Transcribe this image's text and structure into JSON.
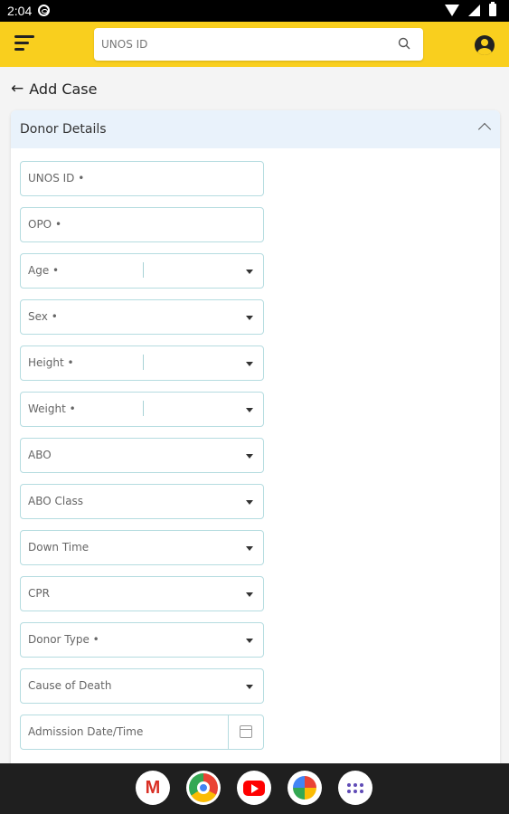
{
  "status_bar": {
    "time": "2:04"
  },
  "header": {
    "search": {
      "placeholder": "UNOS ID",
      "value": ""
    }
  },
  "page": {
    "back_label": "Add Case"
  },
  "section": {
    "title": "Donor Details",
    "fields": [
      {
        "label": "UNOS ID •",
        "kind": "text"
      },
      {
        "label": "OPO •",
        "kind": "text"
      },
      {
        "label": "Age •",
        "kind": "unit-select"
      },
      {
        "label": "Sex •",
        "kind": "select"
      },
      {
        "label": "Height •",
        "kind": "unit-select"
      },
      {
        "label": "Weight •",
        "kind": "unit-select"
      },
      {
        "label": "ABO",
        "kind": "select"
      },
      {
        "label": "ABO Class",
        "kind": "select"
      },
      {
        "label": "Down Time",
        "kind": "select"
      },
      {
        "label": "CPR",
        "kind": "select"
      },
      {
        "label": "Donor Type •",
        "kind": "select"
      },
      {
        "label": "Cause of Death",
        "kind": "select"
      },
      {
        "label": "Admission Date/Time",
        "kind": "date"
      }
    ]
  },
  "nav_dock": [
    "gmail-icon",
    "chrome-icon",
    "youtube-icon",
    "photos-icon",
    "app-drawer-icon"
  ],
  "colors": {
    "header_bg": "#f9cf1e",
    "field_border": "#b5dce0",
    "section_header_bg": "#e9f2fb"
  }
}
